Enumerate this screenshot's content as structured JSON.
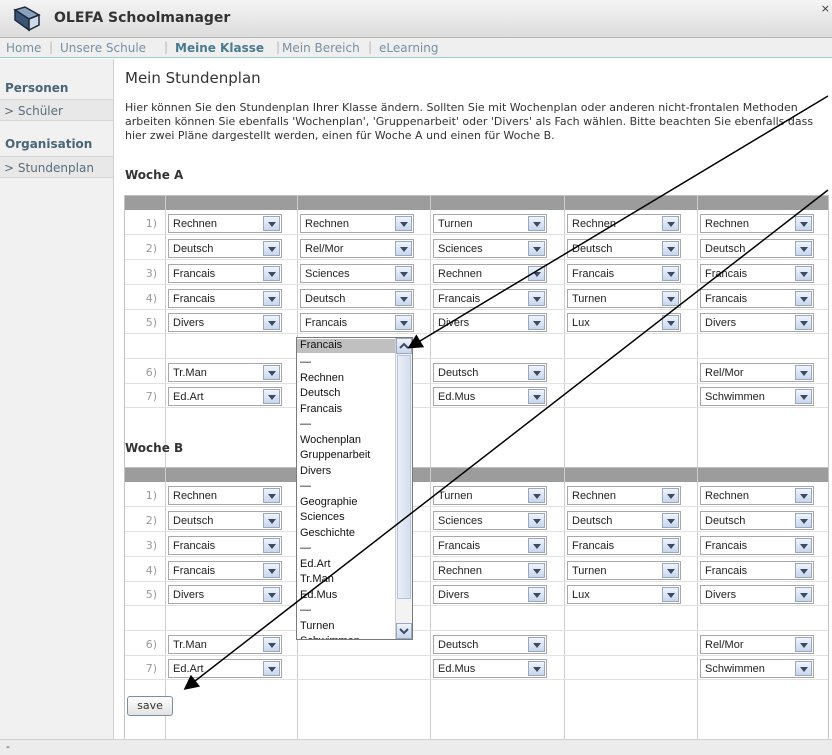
{
  "window": {
    "title": "OLEFA Schoolmanager",
    "close_symbol": "×"
  },
  "nav": {
    "items": [
      "Home",
      "Unsere Schule",
      "Meine Klasse",
      "Mein Bereich",
      "eLearning"
    ],
    "active": "Meine Klasse"
  },
  "sidebar": {
    "sections": [
      {
        "heading": "Personen",
        "items": [
          "> Schüler"
        ]
      },
      {
        "heading": "Organisation",
        "items": [
          "> Stundenplan"
        ]
      }
    ]
  },
  "main": {
    "title": "Mein Stundenplan",
    "intro": "Hier können Sie den Stundenplan Ihrer Klasse ändern. Sollten Sie mit Wochenplan oder anderen nicht-frontalen Methoden arbeiten können Sie ebenfalls 'Wochenplan', 'Gruppenarbeit' oder 'Divers' als Fach wählen. Bitte beachten Sie ebenfalls dass hier zwei Pläne dargestellt werden, einen für Woche A und einen für Woche B."
  },
  "weekA": {
    "title": "Woche A",
    "rows": [
      {
        "num": "1)",
        "cells": [
          "Rechnen",
          "Rechnen",
          "Turnen",
          "Rechnen",
          "Rechnen"
        ]
      },
      {
        "num": "2)",
        "cells": [
          "Deutsch",
          "Rel/Mor",
          "Sciences",
          "Deutsch",
          "Deutsch"
        ]
      },
      {
        "num": "3)",
        "cells": [
          "Francais",
          "Sciences",
          "Rechnen",
          "Francais",
          "Francais"
        ]
      },
      {
        "num": "4)",
        "cells": [
          "Francais",
          "Deutsch",
          "Francais",
          "Turnen",
          "Francais"
        ]
      },
      {
        "num": "5)",
        "cells": [
          "Divers",
          "Francais",
          "Divers",
          "Lux",
          "Divers"
        ]
      },
      {
        "num": "6)",
        "cells": [
          "Tr.Man",
          "",
          "Deutsch",
          "",
          "Rel/Mor"
        ]
      },
      {
        "num": "7)",
        "cells": [
          "Ed.Art",
          "",
          "Ed.Mus",
          "",
          "Schwimmen"
        ]
      }
    ]
  },
  "weekB": {
    "title": "Woche B",
    "rows": [
      {
        "num": "1)",
        "cells": [
          "Rechnen",
          "",
          "Turnen",
          "Rechnen",
          "Rechnen"
        ]
      },
      {
        "num": "2)",
        "cells": [
          "Deutsch",
          "",
          "Sciences",
          "Deutsch",
          "Deutsch"
        ]
      },
      {
        "num": "3)",
        "cells": [
          "Francais",
          "",
          "Francais",
          "Francais",
          "Francais"
        ]
      },
      {
        "num": "4)",
        "cells": [
          "Francais",
          "",
          "Rechnen",
          "Turnen",
          "Francais"
        ]
      },
      {
        "num": "5)",
        "cells": [
          "Divers",
          "",
          "Divers",
          "Lux",
          "Divers"
        ]
      },
      {
        "num": "6)",
        "cells": [
          "Tr.Man",
          "",
          "Deutsch",
          "",
          "Rel/Mor"
        ]
      },
      {
        "num": "7)",
        "cells": [
          "Ed.Art",
          "",
          "Ed.Mus",
          "",
          "Schwimmen"
        ]
      }
    ]
  },
  "dropdown": {
    "selected": "Francais",
    "options": [
      "Francais",
      "—",
      "Rechnen",
      "Deutsch",
      "Francais",
      "—",
      "Wochenplan",
      "Gruppenarbeit",
      "Divers",
      "—",
      "Geographie",
      "Sciences",
      "Geschichte",
      "—",
      "Ed.Art",
      "Tr.Man",
      "Ed.Mus",
      "—",
      "Turnen",
      "Schwimmen"
    ]
  },
  "save_label": "save",
  "statusbar": {
    "text": "-"
  },
  "icons": {
    "app": "book-icon",
    "dropdown": "chevron-down-icon",
    "scroll_up": "chevron-up-icon"
  }
}
